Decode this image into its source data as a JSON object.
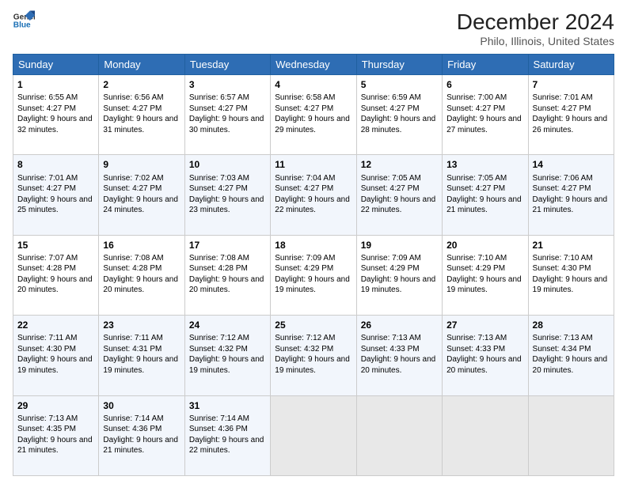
{
  "header": {
    "logo_line1": "General",
    "logo_line2": "Blue",
    "month": "December 2024",
    "location": "Philo, Illinois, United States"
  },
  "weekdays": [
    "Sunday",
    "Monday",
    "Tuesday",
    "Wednesday",
    "Thursday",
    "Friday",
    "Saturday"
  ],
  "weeks": [
    [
      {
        "day": "1",
        "sunrise": "Sunrise: 6:55 AM",
        "sunset": "Sunset: 4:27 PM",
        "daylight": "Daylight: 9 hours and 32 minutes."
      },
      {
        "day": "2",
        "sunrise": "Sunrise: 6:56 AM",
        "sunset": "Sunset: 4:27 PM",
        "daylight": "Daylight: 9 hours and 31 minutes."
      },
      {
        "day": "3",
        "sunrise": "Sunrise: 6:57 AM",
        "sunset": "Sunset: 4:27 PM",
        "daylight": "Daylight: 9 hours and 30 minutes."
      },
      {
        "day": "4",
        "sunrise": "Sunrise: 6:58 AM",
        "sunset": "Sunset: 4:27 PM",
        "daylight": "Daylight: 9 hours and 29 minutes."
      },
      {
        "day": "5",
        "sunrise": "Sunrise: 6:59 AM",
        "sunset": "Sunset: 4:27 PM",
        "daylight": "Daylight: 9 hours and 28 minutes."
      },
      {
        "day": "6",
        "sunrise": "Sunrise: 7:00 AM",
        "sunset": "Sunset: 4:27 PM",
        "daylight": "Daylight: 9 hours and 27 minutes."
      },
      {
        "day": "7",
        "sunrise": "Sunrise: 7:01 AM",
        "sunset": "Sunset: 4:27 PM",
        "daylight": "Daylight: 9 hours and 26 minutes."
      }
    ],
    [
      {
        "day": "8",
        "sunrise": "Sunrise: 7:01 AM",
        "sunset": "Sunset: 4:27 PM",
        "daylight": "Daylight: 9 hours and 25 minutes."
      },
      {
        "day": "9",
        "sunrise": "Sunrise: 7:02 AM",
        "sunset": "Sunset: 4:27 PM",
        "daylight": "Daylight: 9 hours and 24 minutes."
      },
      {
        "day": "10",
        "sunrise": "Sunrise: 7:03 AM",
        "sunset": "Sunset: 4:27 PM",
        "daylight": "Daylight: 9 hours and 23 minutes."
      },
      {
        "day": "11",
        "sunrise": "Sunrise: 7:04 AM",
        "sunset": "Sunset: 4:27 PM",
        "daylight": "Daylight: 9 hours and 22 minutes."
      },
      {
        "day": "12",
        "sunrise": "Sunrise: 7:05 AM",
        "sunset": "Sunset: 4:27 PM",
        "daylight": "Daylight: 9 hours and 22 minutes."
      },
      {
        "day": "13",
        "sunrise": "Sunrise: 7:05 AM",
        "sunset": "Sunset: 4:27 PM",
        "daylight": "Daylight: 9 hours and 21 minutes."
      },
      {
        "day": "14",
        "sunrise": "Sunrise: 7:06 AM",
        "sunset": "Sunset: 4:27 PM",
        "daylight": "Daylight: 9 hours and 21 minutes."
      }
    ],
    [
      {
        "day": "15",
        "sunrise": "Sunrise: 7:07 AM",
        "sunset": "Sunset: 4:28 PM",
        "daylight": "Daylight: 9 hours and 20 minutes."
      },
      {
        "day": "16",
        "sunrise": "Sunrise: 7:08 AM",
        "sunset": "Sunset: 4:28 PM",
        "daylight": "Daylight: 9 hours and 20 minutes."
      },
      {
        "day": "17",
        "sunrise": "Sunrise: 7:08 AM",
        "sunset": "Sunset: 4:28 PM",
        "daylight": "Daylight: 9 hours and 20 minutes."
      },
      {
        "day": "18",
        "sunrise": "Sunrise: 7:09 AM",
        "sunset": "Sunset: 4:29 PM",
        "daylight": "Daylight: 9 hours and 19 minutes."
      },
      {
        "day": "19",
        "sunrise": "Sunrise: 7:09 AM",
        "sunset": "Sunset: 4:29 PM",
        "daylight": "Daylight: 9 hours and 19 minutes."
      },
      {
        "day": "20",
        "sunrise": "Sunrise: 7:10 AM",
        "sunset": "Sunset: 4:29 PM",
        "daylight": "Daylight: 9 hours and 19 minutes."
      },
      {
        "day": "21",
        "sunrise": "Sunrise: 7:10 AM",
        "sunset": "Sunset: 4:30 PM",
        "daylight": "Daylight: 9 hours and 19 minutes."
      }
    ],
    [
      {
        "day": "22",
        "sunrise": "Sunrise: 7:11 AM",
        "sunset": "Sunset: 4:30 PM",
        "daylight": "Daylight: 9 hours and 19 minutes."
      },
      {
        "day": "23",
        "sunrise": "Sunrise: 7:11 AM",
        "sunset": "Sunset: 4:31 PM",
        "daylight": "Daylight: 9 hours and 19 minutes."
      },
      {
        "day": "24",
        "sunrise": "Sunrise: 7:12 AM",
        "sunset": "Sunset: 4:32 PM",
        "daylight": "Daylight: 9 hours and 19 minutes."
      },
      {
        "day": "25",
        "sunrise": "Sunrise: 7:12 AM",
        "sunset": "Sunset: 4:32 PM",
        "daylight": "Daylight: 9 hours and 19 minutes."
      },
      {
        "day": "26",
        "sunrise": "Sunrise: 7:13 AM",
        "sunset": "Sunset: 4:33 PM",
        "daylight": "Daylight: 9 hours and 20 minutes."
      },
      {
        "day": "27",
        "sunrise": "Sunrise: 7:13 AM",
        "sunset": "Sunset: 4:33 PM",
        "daylight": "Daylight: 9 hours and 20 minutes."
      },
      {
        "day": "28",
        "sunrise": "Sunrise: 7:13 AM",
        "sunset": "Sunset: 4:34 PM",
        "daylight": "Daylight: 9 hours and 20 minutes."
      }
    ],
    [
      {
        "day": "29",
        "sunrise": "Sunrise: 7:13 AM",
        "sunset": "Sunset: 4:35 PM",
        "daylight": "Daylight: 9 hours and 21 minutes."
      },
      {
        "day": "30",
        "sunrise": "Sunrise: 7:14 AM",
        "sunset": "Sunset: 4:36 PM",
        "daylight": "Daylight: 9 hours and 21 minutes."
      },
      {
        "day": "31",
        "sunrise": "Sunrise: 7:14 AM",
        "sunset": "Sunset: 4:36 PM",
        "daylight": "Daylight: 9 hours and 22 minutes."
      },
      null,
      null,
      null,
      null
    ]
  ]
}
